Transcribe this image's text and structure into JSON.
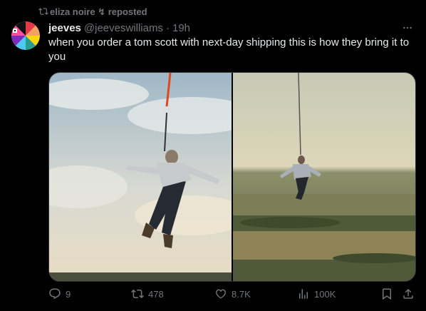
{
  "repost": {
    "label": "eliza noire ↯ reposted",
    "icon": "repost-icon"
  },
  "author": {
    "display_name": "jeeves",
    "handle": "@jeeveswilliams",
    "time": "19h"
  },
  "tweet": {
    "text": "when you order a tom scott with next-day shipping this is how they bring it to you"
  },
  "media": {
    "count": 2,
    "descriptions_visible": false
  },
  "actions": {
    "replies": "9",
    "reposts": "478",
    "likes": "8.7K",
    "views": "100K"
  },
  "colors": {
    "background": "#000000",
    "text": "#e7e9ea",
    "muted": "#71767b"
  }
}
